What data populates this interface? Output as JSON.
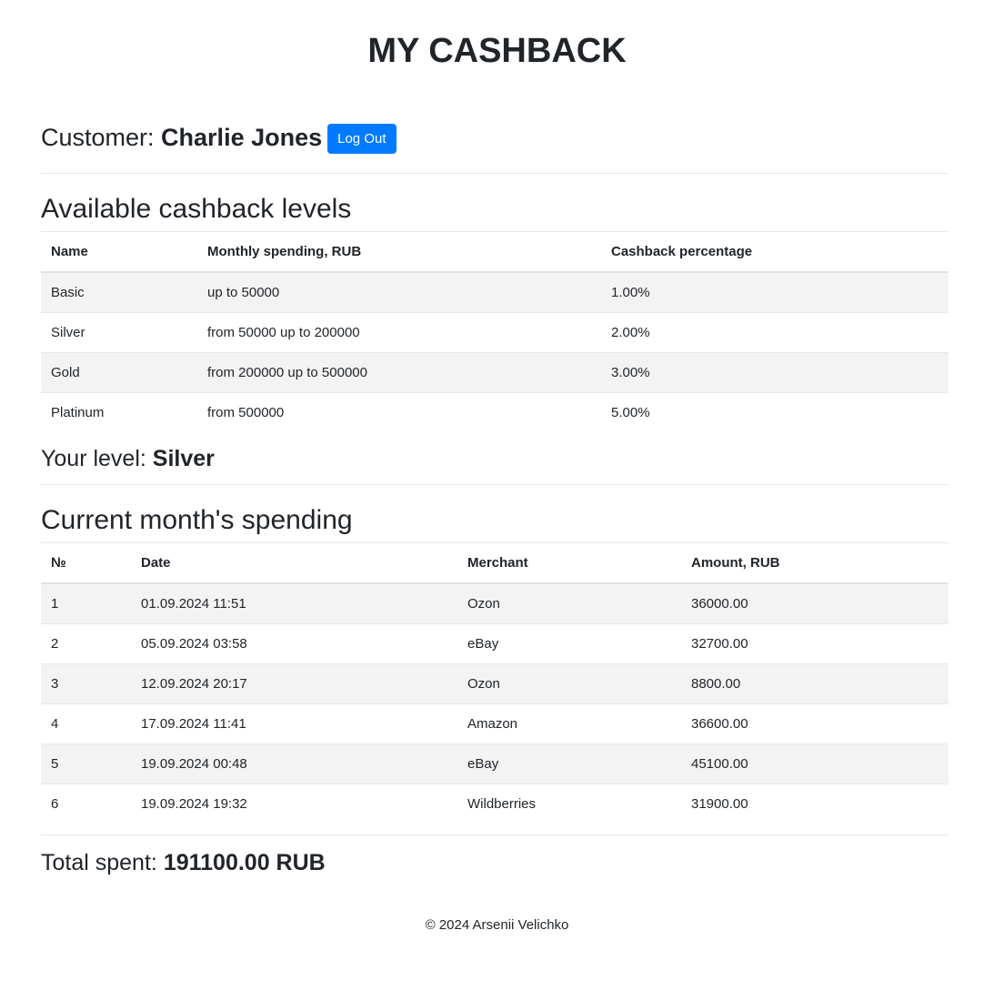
{
  "header": {
    "title": "MY CASHBACK"
  },
  "customer": {
    "label": "Customer: ",
    "name": "Charlie Jones",
    "logout_label": "Log Out"
  },
  "levels": {
    "heading": "Available cashback levels",
    "columns": [
      "Name",
      "Monthly spending, RUB",
      "Cashback percentage"
    ],
    "rows": [
      [
        "Basic",
        "up to 50000",
        "1.00%"
      ],
      [
        "Silver",
        "from 50000 up to 200000",
        "2.00%"
      ],
      [
        "Gold",
        "from 200000 up to 500000",
        "3.00%"
      ],
      [
        "Platinum",
        "from 500000",
        "5.00%"
      ]
    ]
  },
  "your_level": {
    "label": "Your level: ",
    "value": "Silver"
  },
  "spending": {
    "heading": "Current month's spending",
    "columns": [
      "№",
      "Date",
      "Merchant",
      "Amount, RUB"
    ],
    "rows": [
      [
        "1",
        "01.09.2024 11:51",
        "Ozon",
        "36000.00"
      ],
      [
        "2",
        "05.09.2024 03:58",
        "eBay",
        "32700.00"
      ],
      [
        "3",
        "12.09.2024 20:17",
        "Ozon",
        "8800.00"
      ],
      [
        "4",
        "17.09.2024 11:41",
        "Amazon",
        "36600.00"
      ],
      [
        "5",
        "19.09.2024 00:48",
        "eBay",
        "45100.00"
      ],
      [
        "6",
        "19.09.2024 19:32",
        "Wildberries",
        "31900.00"
      ]
    ]
  },
  "total": {
    "label": "Total spent: ",
    "value": "191100.00 RUB"
  },
  "footer": {
    "text": "© 2024 Arsenii Velichko"
  },
  "colors": {
    "primary_button": "#007bff",
    "text": "#212529",
    "stripe": "#f3f3f3"
  }
}
